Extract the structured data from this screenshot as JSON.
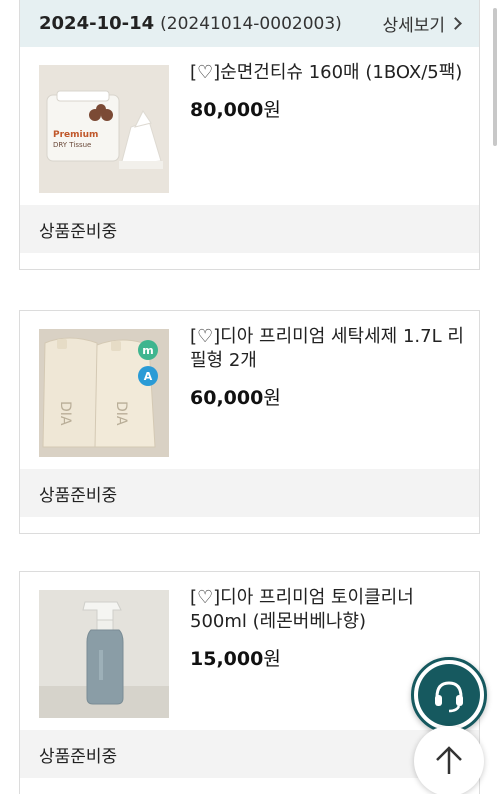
{
  "order": {
    "date": "2024-10-14",
    "order_no": "(20241014-0002003)",
    "detail_label": "상세보기"
  },
  "products": [
    {
      "name": "[♡]순면건티슈 160매 (1BOX/5팩)",
      "price": "80,000",
      "unit": "원",
      "status": "상품준비중",
      "thumb": "dry-tissue-pack"
    },
    {
      "name": "[♡]디아 프리미엄 세탁세제 1.7L 리필형 2개",
      "price": "60,000",
      "unit": "원",
      "status": "상품준비중",
      "thumb": "detergent-refill-pouches"
    },
    {
      "name": "[♡]디아 프리미엄 토이클리너 500ml (레몬버베나향)",
      "price": "15,000",
      "unit": "원",
      "status": "상품준비중",
      "thumb": "spray-bottle"
    }
  ],
  "thumb_text": {
    "tissue_brand": "Premium",
    "tissue_sub": "DRY Tissue",
    "badge_m": "m",
    "badge_a": "A",
    "pouch_label": "DIA"
  },
  "floating": {
    "headset_icon": "headset-icon",
    "top_icon": "arrow-up-icon"
  },
  "colors": {
    "header_bg": "#e6f0f2",
    "status_bg": "#f3f3f3",
    "brand_teal": "#16595f"
  }
}
